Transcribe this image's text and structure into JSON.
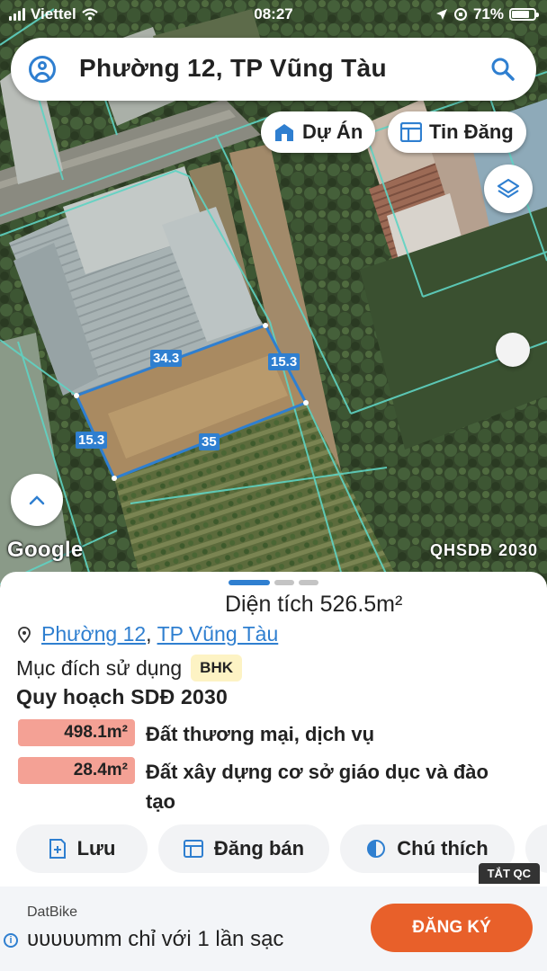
{
  "status_bar": {
    "carrier": "Viettel",
    "time": "08:27",
    "battery": "71%"
  },
  "search": {
    "query": "Phường 12, TP Vũng Tàu"
  },
  "map": {
    "project_button": "Dự Án",
    "listing_button": "Tin Đăng",
    "watermark": "Google",
    "layer_label": "QHSDĐ 2030",
    "plot_dimensions": [
      "34.3",
      "15.3",
      "15.3",
      "35"
    ]
  },
  "sheet": {
    "area": "Diện tích 526.5m²",
    "ward": "Phường 12",
    "separator": ",",
    "city": "TP Vũng Tàu",
    "purpose_label": "Mục đích sử dụng",
    "purpose_badge": "BHK",
    "plan_title": "Quy hoạch SDĐ 2030",
    "plan_items": [
      {
        "amount": "498.1m²",
        "label": "Đất thương mại, dịch vụ"
      },
      {
        "amount": "28.4m²",
        "label": "Đất xây dựng cơ sở giáo dục và đào tạo"
      }
    ],
    "actions": {
      "save": "Lưu",
      "post": "Đăng bán",
      "legend": "Chú thích"
    }
  },
  "ad": {
    "tag": "TẮT QC",
    "brand": "DatBike",
    "message": "ᴜᴜᴜᴜᴜmm chỉ với 1 lần sạc",
    "cta": "ĐĂNG KÝ",
    "info_icon": "i"
  },
  "colors": {
    "accent": "#2f7fd0",
    "plot_outline": "#2f7fd0",
    "parcel_lines": "#5fd3c3",
    "plan_fill": "#f4a195",
    "cta": "#e8602a"
  }
}
